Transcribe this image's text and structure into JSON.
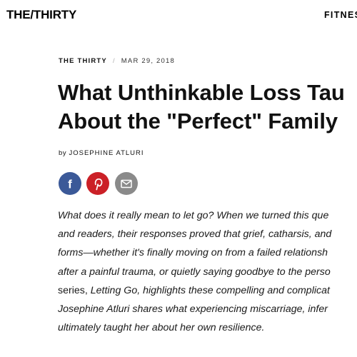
{
  "header": {
    "logo": "THE/THIRTY",
    "nav_item": "FITNES"
  },
  "article": {
    "section": "THE THIRTY",
    "separator": "/",
    "date": "MAR 29, 2018",
    "headline_line1": "What Unthinkable Loss Tau",
    "headline_line2": "About the \"Perfect\" Family",
    "byline_prefix": "by",
    "author": "JOSEPHINE ATLURI",
    "intro_lines": [
      "What does it really mean to let go? When we turned this que",
      "and readers, their responses proved that grief, catharsis, and",
      "forms—whether it's finally moving on from a failed relationsh",
      "after a painful trauma, or quietly saying goodbye to the perso",
      {
        "upright_1": "series,",
        "italic": " Letting Go, ",
        "upright_2": "highlights these compelling and complicat"
      },
      "Josephine Atluri shares what experiencing miscarriage, infer",
      "ultimately taught her about her own resilience."
    ]
  },
  "share": {
    "facebook_icon": "facebook-icon",
    "pinterest_icon": "pinterest-icon",
    "email_icon": "email-icon",
    "colors": {
      "facebook": "#3b5998",
      "pinterest": "#cb2027",
      "email": "#8a8a8a"
    }
  }
}
